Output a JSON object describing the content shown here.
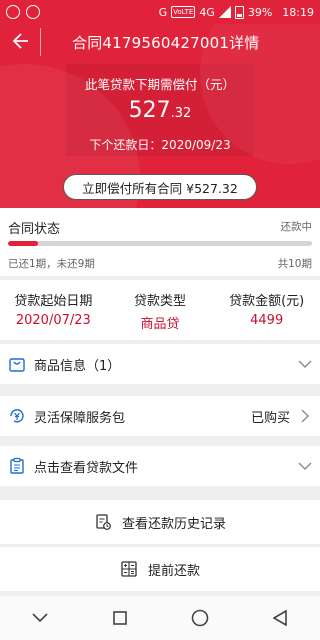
{
  "status_bar": {
    "carrier": "G",
    "volte": "VoLTE",
    "network": "4G",
    "battery": "39%",
    "time": "18:19"
  },
  "header": {
    "title": "合同4179560427001详情",
    "next_payment_label": "此笔贷款下期需偿付（元）",
    "amount_integer": "527",
    "amount_decimal": ".32",
    "next_due_label": "下个还款日：",
    "next_due_date": "2020/09/23",
    "pay_all_button": "立即偿付所有合同 ¥527.32"
  },
  "contract_status": {
    "title": "合同状态",
    "badge": "还款中",
    "progress_text": "已还1期，未还9期",
    "total_periods": "共10期",
    "progress_fraction": 0.1,
    "accent": "#e0223a"
  },
  "loan_info": [
    {
      "label": "贷款起始日期",
      "value": "2020/07/23"
    },
    {
      "label": "贷款类型",
      "value": "商品贷"
    },
    {
      "label": "贷款金额(元)",
      "value": "4499"
    }
  ],
  "rows": {
    "product_info": {
      "label": "商品信息（1）",
      "icon": "shopping-bag-icon"
    },
    "service_package": {
      "label": "灵活保障服务包",
      "value": "已购买",
      "icon": "yuan-refresh-icon"
    },
    "loan_documents": {
      "label": "点击查看贷款文件",
      "icon": "clipboard-icon"
    }
  },
  "actions": {
    "history": {
      "label": "查看还款历史记录",
      "icon": "document-clock-icon"
    },
    "prepay": {
      "label": "提前还款",
      "icon": "calculator-icon"
    }
  },
  "colors": {
    "brand_red": "#e0223a",
    "value_red": "#c8102e",
    "background": "#efefef"
  }
}
